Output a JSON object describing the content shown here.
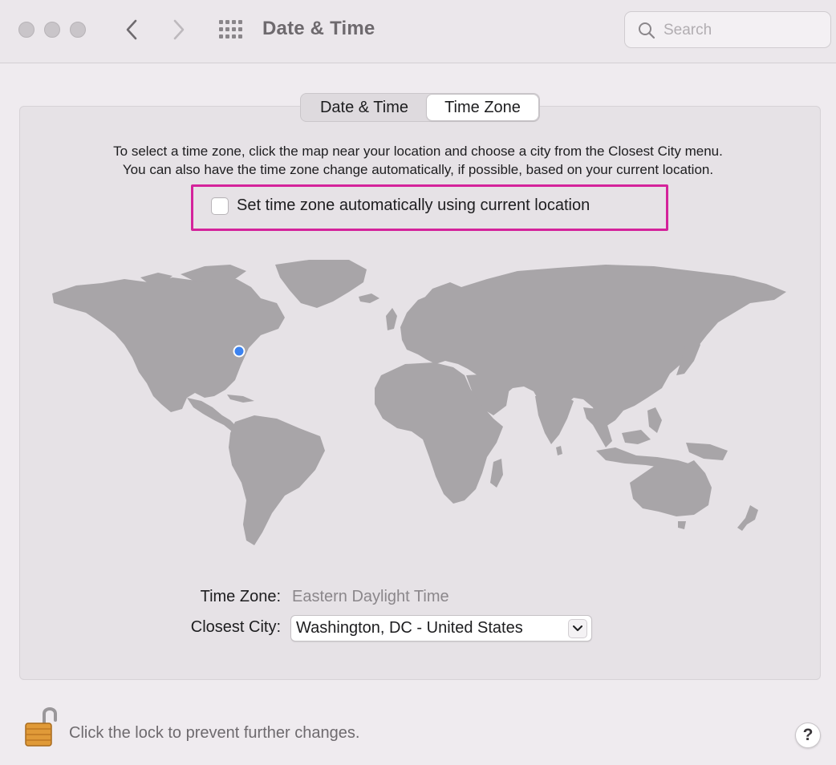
{
  "window": {
    "title": "Date & Time",
    "search_placeholder": "Search"
  },
  "toolbar": {
    "back_icon": "chevron-left-icon",
    "forward_icon": "chevron-right-icon",
    "grid_icon": "show-all-grid-icon",
    "search_icon": "search-icon"
  },
  "tabs": [
    {
      "label": "Date & Time",
      "active": false
    },
    {
      "label": "Time Zone",
      "active": true
    }
  ],
  "instructions": {
    "line1": "To select a time zone, click the map near your location and choose a city from the Closest City menu.",
    "line2": "You can also have the time zone change automatically, if possible, based on your current location."
  },
  "auto_timezone": {
    "label": "Set time zone automatically using current location",
    "checked": false
  },
  "map": {
    "selected_location": "Washington, DC"
  },
  "time_zone": {
    "label": "Time Zone:",
    "value": "Eastern Daylight Time"
  },
  "closest_city": {
    "label": "Closest City:",
    "value": "Washington, DC - United States"
  },
  "footer": {
    "lock_text": "Click the lock to prevent further changes.",
    "lock_icon": "unlocked-padlock-icon",
    "help_label": "?"
  },
  "colors": {
    "highlight": "#d4239b",
    "land": "#a8a5a8",
    "location_pin": "#3b82f0"
  }
}
